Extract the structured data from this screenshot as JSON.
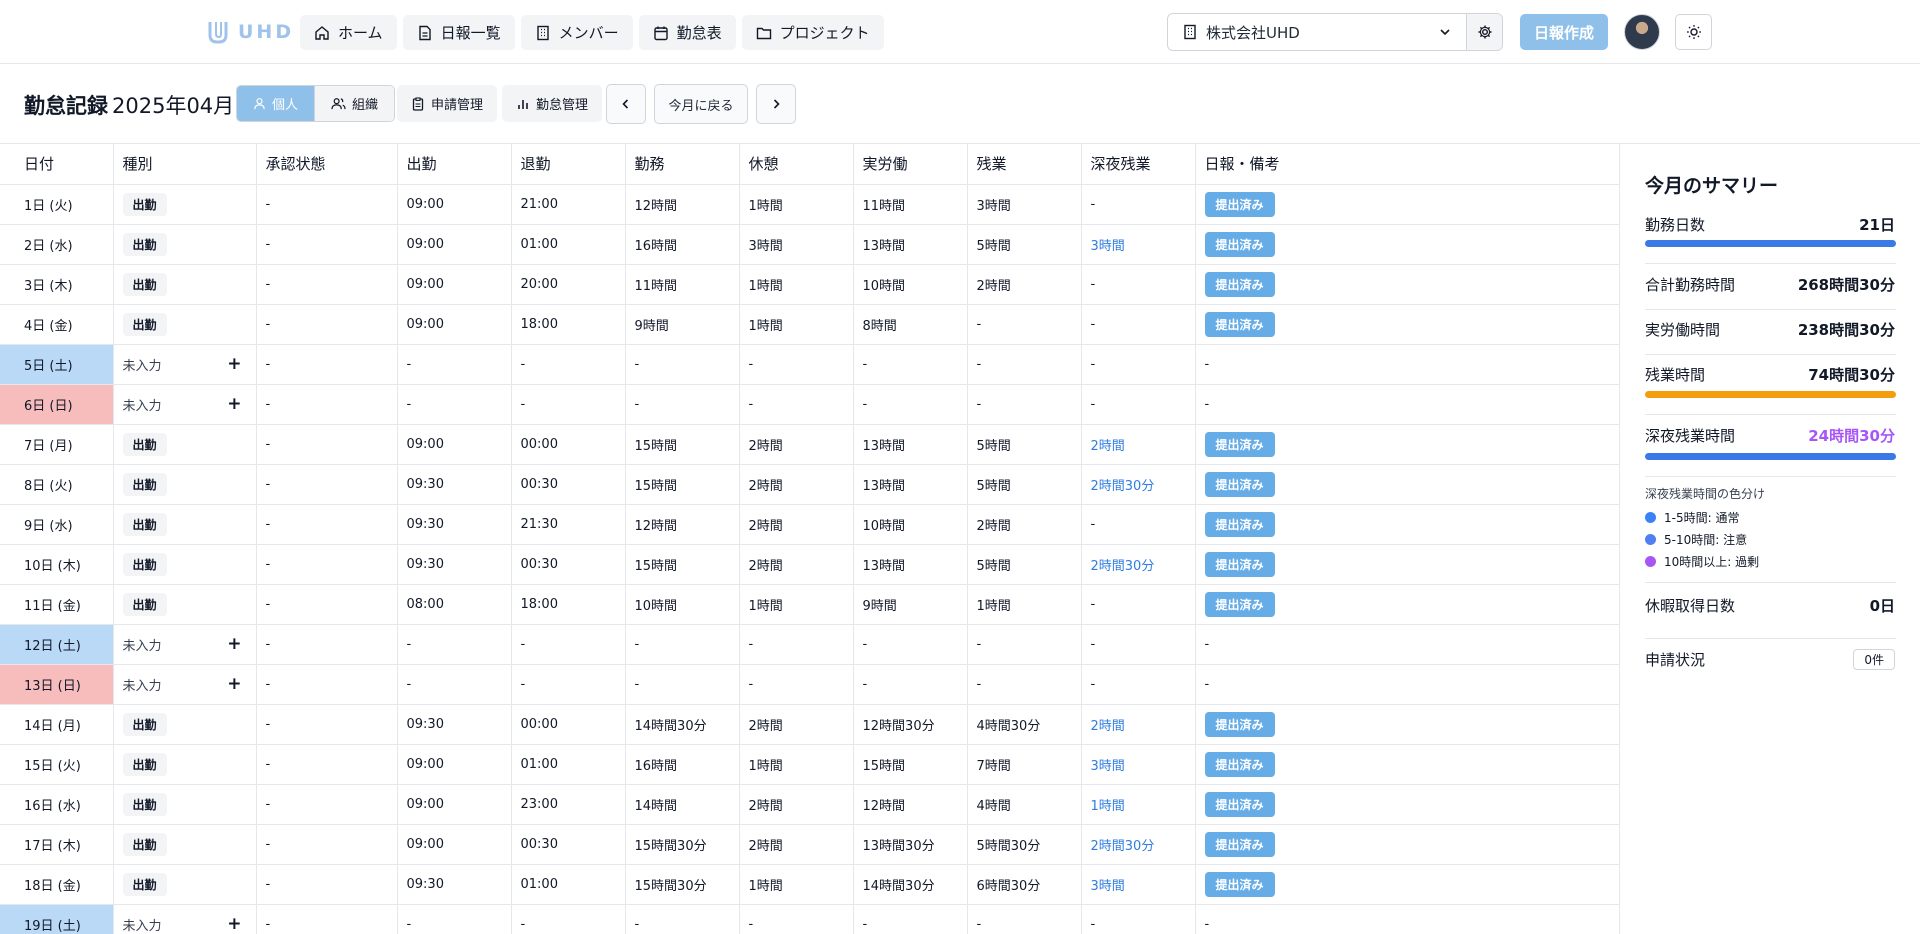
{
  "header": {
    "logo_text": "UHD",
    "nav": [
      {
        "label": "ホーム",
        "icon": "home-icon"
      },
      {
        "label": "日報一覧",
        "icon": "document-icon"
      },
      {
        "label": "メンバー",
        "icon": "building-icon"
      },
      {
        "label": "勤怠表",
        "icon": "calendar-icon"
      },
      {
        "label": "プロジェクト",
        "icon": "folder-icon"
      }
    ],
    "company": "株式会社UHD",
    "create_label": "日報作成"
  },
  "toolbar": {
    "title": "勤怠記録",
    "month": "2025年04月",
    "view_personal": "個人",
    "view_org": "組織",
    "request_label": "申請管理",
    "attendance_label": "勤怠管理",
    "today_label": "今月に戻る"
  },
  "table": {
    "columns": [
      "日付",
      "種別",
      "承認状態",
      "出勤",
      "退勤",
      "勤務",
      "休憩",
      "実労働",
      "残業",
      "深夜残業",
      "日報・備考"
    ],
    "rows": [
      {
        "date": "1日 (火)",
        "day": "weekday",
        "type": "出勤",
        "approval": "-",
        "in": "09:00",
        "out": "21:00",
        "work": "12時間",
        "break": "1時間",
        "actual": "11時間",
        "overtime": "3時間",
        "night": "-",
        "report": "提出済み"
      },
      {
        "date": "2日 (水)",
        "day": "weekday",
        "type": "出勤",
        "approval": "-",
        "in": "09:00",
        "out": "01:00",
        "work": "16時間",
        "break": "3時間",
        "actual": "13時間",
        "overtime": "5時間",
        "night": "3時間",
        "report": "提出済み"
      },
      {
        "date": "3日 (木)",
        "day": "weekday",
        "type": "出勤",
        "approval": "-",
        "in": "09:00",
        "out": "20:00",
        "work": "11時間",
        "break": "1時間",
        "actual": "10時間",
        "overtime": "2時間",
        "night": "-",
        "report": "提出済み"
      },
      {
        "date": "4日 (金)",
        "day": "weekday",
        "type": "出勤",
        "approval": "-",
        "in": "09:00",
        "out": "18:00",
        "work": "9時間",
        "break": "1時間",
        "actual": "8時間",
        "overtime": "-",
        "night": "-",
        "report": "提出済み"
      },
      {
        "date": "5日 (土)",
        "day": "sat",
        "type": "未入力",
        "approval": "-",
        "in": "-",
        "out": "-",
        "work": "-",
        "break": "-",
        "actual": "-",
        "overtime": "-",
        "night": "-",
        "report": "-"
      },
      {
        "date": "6日 (日)",
        "day": "sun",
        "type": "未入力",
        "approval": "-",
        "in": "-",
        "out": "-",
        "work": "-",
        "break": "-",
        "actual": "-",
        "overtime": "-",
        "night": "-",
        "report": "-"
      },
      {
        "date": "7日 (月)",
        "day": "weekday",
        "type": "出勤",
        "approval": "-",
        "in": "09:00",
        "out": "00:00",
        "work": "15時間",
        "break": "2時間",
        "actual": "13時間",
        "overtime": "5時間",
        "night": "2時間",
        "report": "提出済み"
      },
      {
        "date": "8日 (火)",
        "day": "weekday",
        "type": "出勤",
        "approval": "-",
        "in": "09:30",
        "out": "00:30",
        "work": "15時間",
        "break": "2時間",
        "actual": "13時間",
        "overtime": "5時間",
        "night": "2時間30分",
        "report": "提出済み"
      },
      {
        "date": "9日 (水)",
        "day": "weekday",
        "type": "出勤",
        "approval": "-",
        "in": "09:30",
        "out": "21:30",
        "work": "12時間",
        "break": "2時間",
        "actual": "10時間",
        "overtime": "2時間",
        "night": "-",
        "report": "提出済み"
      },
      {
        "date": "10日 (木)",
        "day": "weekday",
        "type": "出勤",
        "approval": "-",
        "in": "09:30",
        "out": "00:30",
        "work": "15時間",
        "break": "2時間",
        "actual": "13時間",
        "overtime": "5時間",
        "night": "2時間30分",
        "report": "提出済み"
      },
      {
        "date": "11日 (金)",
        "day": "weekday",
        "type": "出勤",
        "approval": "-",
        "in": "08:00",
        "out": "18:00",
        "work": "10時間",
        "break": "1時間",
        "actual": "9時間",
        "overtime": "1時間",
        "night": "-",
        "report": "提出済み"
      },
      {
        "date": "12日 (土)",
        "day": "sat",
        "type": "未入力",
        "approval": "-",
        "in": "-",
        "out": "-",
        "work": "-",
        "break": "-",
        "actual": "-",
        "overtime": "-",
        "night": "-",
        "report": "-"
      },
      {
        "date": "13日 (日)",
        "day": "sun",
        "type": "未入力",
        "approval": "-",
        "in": "-",
        "out": "-",
        "work": "-",
        "break": "-",
        "actual": "-",
        "overtime": "-",
        "night": "-",
        "report": "-"
      },
      {
        "date": "14日 (月)",
        "day": "weekday",
        "type": "出勤",
        "approval": "-",
        "in": "09:30",
        "out": "00:00",
        "work": "14時間30分",
        "break": "2時間",
        "actual": "12時間30分",
        "overtime": "4時間30分",
        "night": "2時間",
        "report": "提出済み"
      },
      {
        "date": "15日 (火)",
        "day": "weekday",
        "type": "出勤",
        "approval": "-",
        "in": "09:00",
        "out": "01:00",
        "work": "16時間",
        "break": "1時間",
        "actual": "15時間",
        "overtime": "7時間",
        "night": "3時間",
        "report": "提出済み"
      },
      {
        "date": "16日 (水)",
        "day": "weekday",
        "type": "出勤",
        "approval": "-",
        "in": "09:00",
        "out": "23:00",
        "work": "14時間",
        "break": "2時間",
        "actual": "12時間",
        "overtime": "4時間",
        "night": "1時間",
        "report": "提出済み"
      },
      {
        "date": "17日 (木)",
        "day": "weekday",
        "type": "出勤",
        "approval": "-",
        "in": "09:00",
        "out": "00:30",
        "work": "15時間30分",
        "break": "2時間",
        "actual": "13時間30分",
        "overtime": "5時間30分",
        "night": "2時間30分",
        "report": "提出済み"
      },
      {
        "date": "18日 (金)",
        "day": "weekday",
        "type": "出勤",
        "approval": "-",
        "in": "09:30",
        "out": "01:00",
        "work": "15時間30分",
        "break": "1時間",
        "actual": "14時間30分",
        "overtime": "6時間30分",
        "night": "3時間",
        "report": "提出済み"
      },
      {
        "date": "19日 (土)",
        "day": "sat",
        "type": "未入力",
        "approval": "-",
        "in": "-",
        "out": "-",
        "work": "-",
        "break": "-",
        "actual": "-",
        "overtime": "-",
        "night": "-",
        "report": "-"
      }
    ]
  },
  "summary": {
    "title": "今月のサマリー",
    "work_days_label": "勤務日数",
    "work_days": "21日",
    "total_label": "合計勤務時間",
    "total": "268時間30分",
    "actual_label": "実労働時間",
    "actual": "238時間30分",
    "overtime_label": "残業時間",
    "overtime": "74時間30分",
    "night_label": "深夜残業時間",
    "night": "24時間30分",
    "legend_title": "深夜残業時間の色分け",
    "legend": [
      {
        "label": "1-5時間: 通常",
        "color": "#3b82f6"
      },
      {
        "label": "5-10時間: 注意",
        "color": "#4f7ff0"
      },
      {
        "label": "10時間以上: 過剰",
        "color": "#a855f7"
      }
    ],
    "leave_label": "休暇取得日数",
    "leave": "0日",
    "request_label": "申請状況",
    "request": "0件",
    "colors": {
      "work_bar": "#3b7ae6",
      "overtime_bar": "#f59e0b",
      "night_bar": "#3b7ae6",
      "night_value": "#a855f7"
    }
  }
}
